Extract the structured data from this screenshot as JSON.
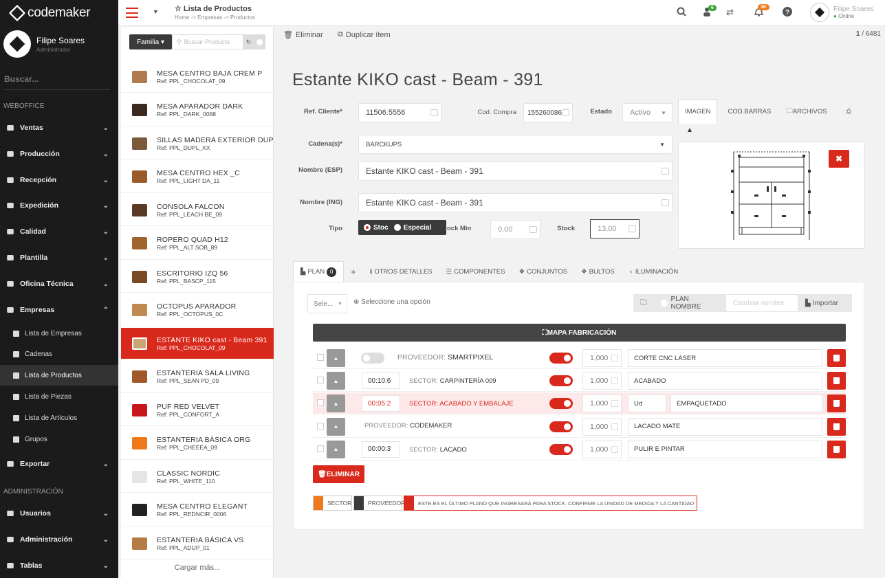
{
  "sidebar": {
    "logo_text": "codemaker",
    "user_name": "Filipe Soares",
    "user_role": "Administrador",
    "search_placeholder": "Buscar...",
    "section_weboffice": "WEBOFFICE",
    "section_admin": "ADMINISTRACIÓN",
    "items": [
      {
        "label": "Ventas"
      },
      {
        "label": "Producción"
      },
      {
        "label": "Recepción"
      },
      {
        "label": "Expedición"
      },
      {
        "label": "Calidad"
      },
      {
        "label": "Plantilla"
      },
      {
        "label": "Oficina Técnica"
      },
      {
        "label": "Empresas"
      }
    ],
    "subitems": [
      {
        "label": "Lista de Empresas"
      },
      {
        "label": "Cadenas"
      },
      {
        "label": "Lista de Productos"
      },
      {
        "label": "Lista de Piezas"
      },
      {
        "label": "Lista de Artículos"
      },
      {
        "label": "Grupos"
      }
    ],
    "export_label": "Exportar",
    "admin_items": [
      {
        "label": "Usuarios"
      },
      {
        "label": "Administración"
      },
      {
        "label": "Tablas"
      }
    ]
  },
  "topbar": {
    "title": "☆ Lista de Productos",
    "breadcrumb": "Home -> Empresas -> Productos",
    "badge_users": "6",
    "badge_bell": "3K",
    "user_name": "Filipe Soares",
    "user_status": "Online"
  },
  "list": {
    "family_label": "Familia ▾",
    "search_placeholder": "Buscar Producto",
    "load_more": "Cargar más...",
    "products": [
      {
        "name": "MESA CENTRO BAJA CREM P",
        "ref": "Ref: PPL_CHOCOLAT_09",
        "color": "#b07b4f"
      },
      {
        "name": "MESA APARADOR DARK",
        "ref": "Ref: PPL_DARK_0068",
        "color": "#3a2a20"
      },
      {
        "name": "SILLAS MADERA EXTERIOR DUP",
        "ref": "Ref: PPL_DUPL_XX",
        "color": "#7a5a3a"
      },
      {
        "name": "MESA CENTRO HEX _C",
        "ref": "Ref: PPL_LIGHT DA_11",
        "color": "#9a5b2a"
      },
      {
        "name": "CONSOLA FALCON",
        "ref": "Ref: PPL_LEACH BE_09",
        "color": "#5a3a25"
      },
      {
        "name": "ROPERO QUAD H12",
        "ref": "Ref: PPL_ALT SOB_89",
        "color": "#a0652f"
      },
      {
        "name": "ESCRITORIO IZQ 56",
        "ref": "Ref: PPL_BASCP_115",
        "color": "#7b4a24"
      },
      {
        "name": "OCTOPUS APARADOR",
        "ref": "Ref: PPL_OCTOPUS_0C",
        "color": "#c08a50"
      },
      {
        "name": "ESTANTE KIKO cast - Beam 391",
        "ref": "Ref: PPL_CHOCOLAT_09",
        "color": "#c9a57a"
      },
      {
        "name": "ESTANTERIA SALA LIVING",
        "ref": "Ref: PPL_SEAN PD_09",
        "color": "#a0582a"
      },
      {
        "name": "PUF RED VELVET",
        "ref": "Ref: PPL_CONFORT_A",
        "color": "#c8161d"
      },
      {
        "name": "ESTANTERIA BÁSICA ORG",
        "ref": "Ref: PPL_CHEEEA_09",
        "color": "#f07a1a"
      },
      {
        "name": "CLASSIC NORDIC",
        "ref": "Ref: PPL_WHITE_110",
        "color": "#e5e5e5"
      },
      {
        "name": "MESA CENTRO ELEGANT",
        "ref": "Ref: PPL_REDNCIR_0006",
        "color": "#222222"
      },
      {
        "name": "ESTANTERIA BÁSICA VS",
        "ref": "Ref: PPL_ADUP_01",
        "color": "#b57b45"
      }
    ]
  },
  "main": {
    "delete_label": "Eliminar",
    "duplicate_label": "Duplicar ítem",
    "count_current": "1",
    "count_total": "/ 6481",
    "title": "Estante KIKO cast - Beam - 391",
    "ref_cliente_label": "Ref. Cliente*",
    "ref_cliente_value": "11506.5556",
    "cod_compra_label": "Cod. Compra",
    "cod_compra_value": "155260086",
    "estado_label": "Estado",
    "estado_value": "Activo",
    "cadena_label": "Cadena(s)*",
    "cadena_value": "BARCKUPS",
    "nombre_esp_label": "Nombre (ESP)",
    "nombre_esp_value": "Estante KIKO cast - Beam - 391",
    "nombre_ing_label": "Nombre (ING)",
    "nombre_ing_value": "Estante KIKO cast - Beam - 391",
    "tipo_label": "Tipo",
    "tipo_stock": "Stoc",
    "tipo_especial": "Especial",
    "stock_min_label": "ock Min",
    "stock_min_value": "0,00",
    "stock_label": "Stock",
    "stock_value": "13,00",
    "img_tabs": [
      "IMAGEN",
      "COD.BARRAS",
      "ARCHIVOS"
    ],
    "tabs": {
      "plan": "PLAN",
      "plan_count": "0",
      "plus": "+",
      "otros": "OTROS DETALLES",
      "componentes": "COMPONENTES",
      "conjuntos": "CONJUNTOS",
      "bultos": "BULTOS",
      "iluminacion": "ILUMINACIÓN"
    },
    "select_placeholder": "Sele...",
    "select_hint": "Seleccione una opción",
    "plan_nombre": "PLAN NOMBRE",
    "cambiar_placeholder": "Cambiar nombre",
    "importar": "Importar",
    "mapa_label": "MAPA FABRICACIÓN",
    "rows": [
      {
        "time": "",
        "prefix": "PROVEEDOR:",
        "name": "SMARTPIXEL",
        "qty": "1,000",
        "unit": "",
        "desc": "CORTE CNC LASER",
        "on": true,
        "hl": false
      },
      {
        "time": "00:10:6",
        "prefix": "SECTOR:",
        "name": "CARPINTERÍA 009",
        "qty": "1,000",
        "unit": "",
        "desc": "ACABADO",
        "on": true,
        "hl": false
      },
      {
        "time": "00:05:2",
        "prefix": "SECTOR:",
        "name": "ACABADO Y EMBALAJE",
        "qty": "1,000",
        "unit": "Ud",
        "desc": "EMPAQUETADO",
        "on": true,
        "hl": true
      },
      {
        "time": "",
        "prefix": "PROVEEDOR:",
        "name": "CODEMAKER",
        "qty": "1,000",
        "unit": "",
        "desc": "LACADO MATE",
        "on": true,
        "hl": false
      },
      {
        "time": "00:00:3",
        "prefix": "SECTOR:",
        "name": "LACADO",
        "qty": "1,000",
        "unit": "",
        "desc": "PULIR E PINTAR",
        "on": true,
        "hl": false
      }
    ],
    "eliminar_btn": "ELIMINAR",
    "legend_sector": "SECTOR",
    "legend_proveedor": "PROVEEDOR",
    "legend_note": "ESTE ES EL ÚLTIMO PLANO QUE INGRESARÁ PARA STOCK. CONFIRME LA UNIDAD DE MEDIDA Y LA CANTIDAD",
    "colors": {
      "accent": "#d9291c",
      "sector": "#f07a1a",
      "proveedor": "#3a3a3a"
    }
  }
}
